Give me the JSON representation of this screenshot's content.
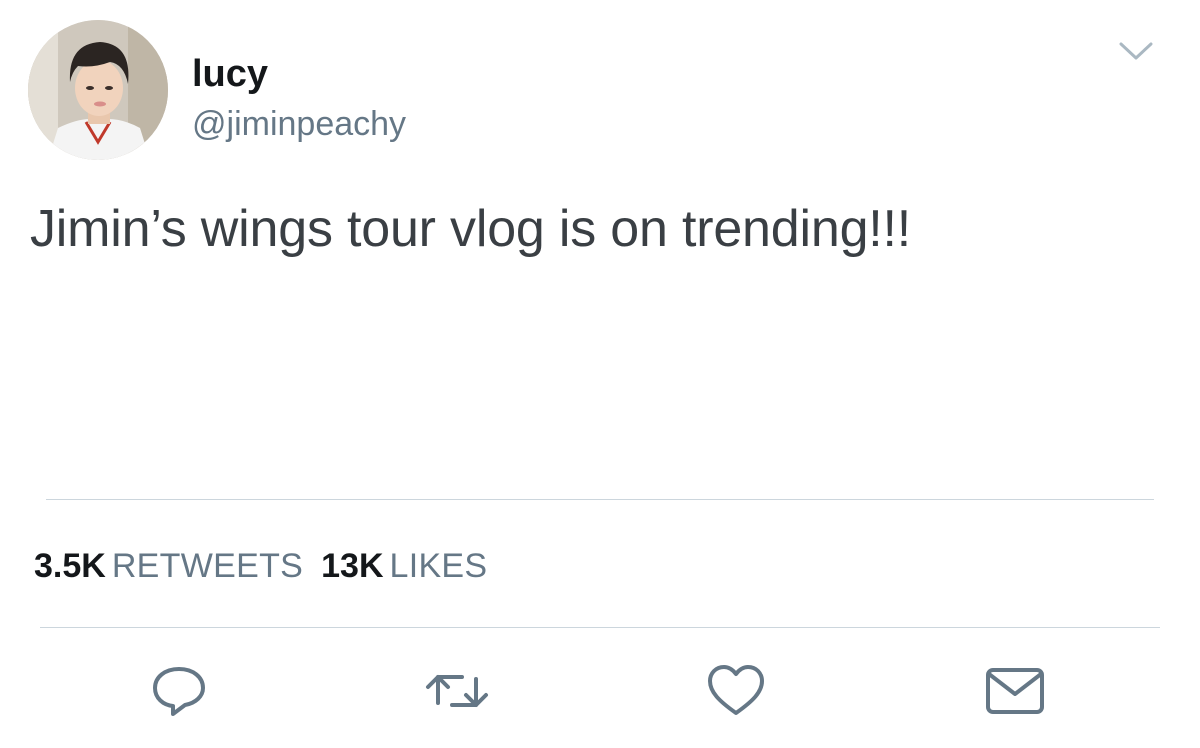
{
  "tweet": {
    "author": {
      "display_name": "lucy",
      "handle": "@jiminpeachy",
      "avatar_icon": "avatar-photo"
    },
    "text": "Jimin’s wings tour vlog is on trending!!!",
    "stats": {
      "retweets_count": "3.5K",
      "retweets_label": "RETWEETS",
      "likes_count": "13K",
      "likes_label": "LIKES"
    },
    "actions": {
      "reply_icon": "reply-icon",
      "retweet_icon": "retweet-icon",
      "like_icon": "heart-icon",
      "message_icon": "envelope-icon"
    },
    "menu_icon": "chevron-down-icon"
  },
  "colors": {
    "text_primary": "#14171a",
    "text_secondary": "#657786",
    "divider": "#ccd6dd",
    "icon": "#657786"
  }
}
